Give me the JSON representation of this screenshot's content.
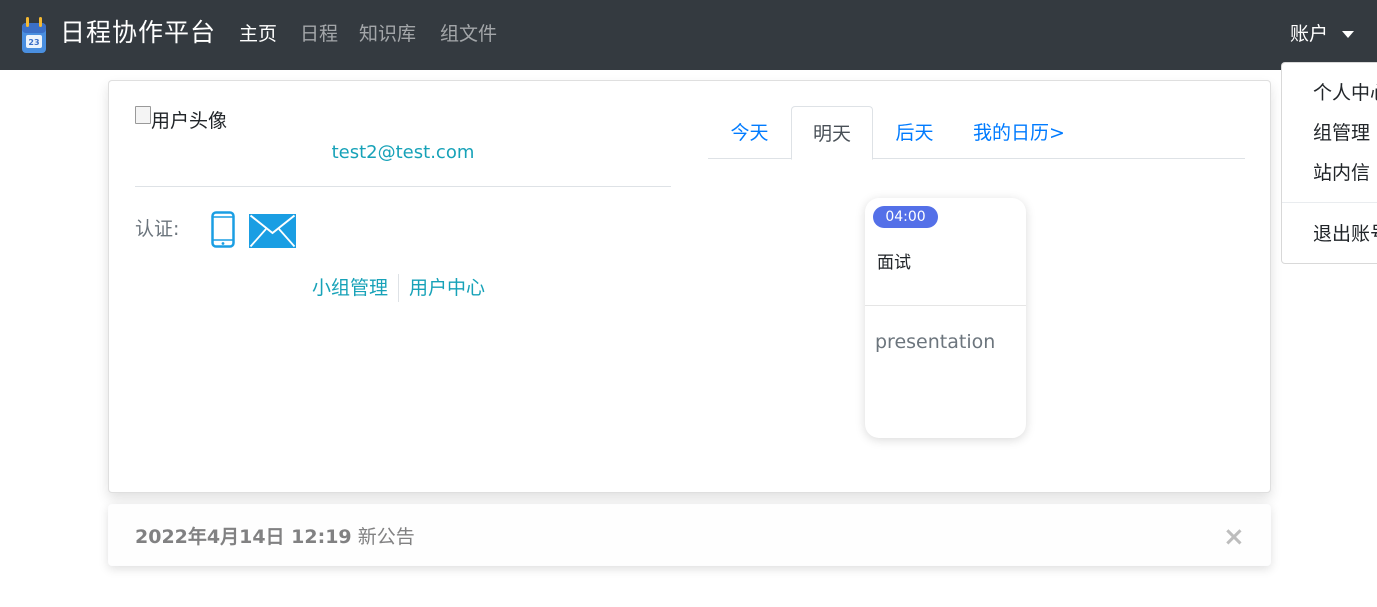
{
  "navbar": {
    "brand": "日程协作平台",
    "links": [
      "主页",
      "日程",
      "知识库",
      "组文件"
    ],
    "active_index": 0,
    "account": "账户"
  },
  "dropdown": {
    "items": [
      "个人中心",
      "组管理",
      "站内信"
    ],
    "logout": "退出账号"
  },
  "profile": {
    "avatar_alt": "用户头像",
    "email": "test2@test.com",
    "verify_label": "认证:",
    "icons": [
      "phone-icon",
      "mail-icon"
    ],
    "links": [
      "小组管理",
      "用户中心"
    ]
  },
  "tabs": {
    "items": [
      "今天",
      "明天",
      "后天",
      "我的日历>"
    ],
    "active_index": 1
  },
  "schedule": {
    "time": "04:00",
    "title": "面试",
    "description": "presentation"
  },
  "notice": {
    "date": "2022年4月14日 12:19",
    "text": "新公告",
    "close": "×"
  },
  "colors": {
    "navbar_bg": "#343a40",
    "link": "#17a2b8",
    "tab_link": "#007bff",
    "badge": "#5470e8",
    "icon_blue": "#1a9ee3"
  }
}
